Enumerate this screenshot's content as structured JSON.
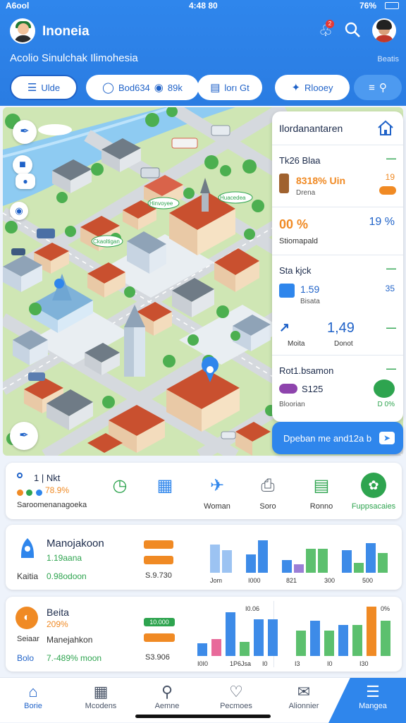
{
  "status_bar": {
    "carrier": "A6ool",
    "time": "4:48 80",
    "battery": "76%"
  },
  "header": {
    "app_title": "Inoneia",
    "notification_count": "2",
    "subtitle": "Acolio Sinulchak Ilimohesia",
    "subtitle_right": "Beatis"
  },
  "tabs": [
    {
      "label": "Ulde",
      "icon": "list-icon"
    },
    {
      "label": "Bod634",
      "label2": "89k",
      "icon": "pin-icon"
    },
    {
      "label": "lorı Gt",
      "icon": "card-icon"
    },
    {
      "label": "Rlooey",
      "icon": "compass-icon"
    }
  ],
  "map_labels": {
    "label1": "Ckaoltigan",
    "label2": "Huacedea",
    "label3": "Hinvoyee"
  },
  "panel": {
    "title": "Ilordanantaren",
    "section1": {
      "title": "Tk26 Blaa",
      "value": "8318% Uin",
      "sub": "Drena",
      "right_value": "19"
    },
    "section2": {
      "value_left": "00 %",
      "value_right": "19 %",
      "sub": "Stiomapald"
    },
    "section3": {
      "title": "Sta kjck",
      "value": "1.59",
      "right_value": "35",
      "sub": "Bisata",
      "value2": "1,49",
      "label_left": "Moita",
      "label_right": "Donot"
    },
    "section4": {
      "title": "Rot1.bsamon",
      "value": "S125",
      "sub": "Bloorian",
      "right_value": "D 0%"
    }
  },
  "cta": {
    "label": "Dpeban me and12a b"
  },
  "quick_card": {
    "stat_num": "1 | Nkt",
    "stat_pct": "78.9%",
    "caption": "Saroomenanagoeka",
    "actions": [
      {
        "label": "",
        "icon": "clock-icon"
      },
      {
        "label": "",
        "icon": "grid-icon"
      },
      {
        "label": "Woman",
        "icon": "plane-icon"
      },
      {
        "label": "Soro",
        "icon": "printer-icon"
      },
      {
        "label": "Ronno",
        "icon": "document-icon"
      },
      {
        "label": "Fuppsacaies",
        "icon": "leaf-icon"
      }
    ]
  },
  "stats_card1": {
    "title": "Manojakoon",
    "value": "1.19aana",
    "label": "Kaitia",
    "value2": "0.98odoon",
    "pill1": "",
    "pill2": "",
    "amount": "S.9.730",
    "chart_labels": [
      "Jom",
      "I000",
      "821",
      "300",
      "500"
    ]
  },
  "stats_card2": {
    "title": "Beita",
    "value": "209%",
    "label1": "Seiaar",
    "label2": "Manejahkon",
    "label3": "Bolo",
    "value2": "7.-489% moon",
    "pill1": "10.000",
    "pill2": "",
    "amount": "S3.906",
    "chart_top": "I0.06",
    "chart_top2": "0%",
    "chart_labels": [
      "I0I0",
      "1P6Jsa",
      "I0",
      "I3",
      "I0",
      "I30"
    ]
  },
  "bottom_nav": [
    {
      "label": "Borie",
      "icon": "home-icon"
    },
    {
      "label": "Mcodens",
      "icon": "store-icon"
    },
    {
      "label": "Aemne",
      "icon": "search-icon"
    },
    {
      "label": "Pecmoes",
      "icon": "heart-icon"
    },
    {
      "label": "Alionnier",
      "icon": "box-icon"
    },
    {
      "label": "Mangea",
      "icon": "menu-icon"
    }
  ],
  "colors": {
    "primary": "#2f86ec",
    "green": "#2ea44f",
    "orange": "#f08a24",
    "blue_bar": "#3d8be8",
    "purple_bar": "#9b7fd6"
  }
}
